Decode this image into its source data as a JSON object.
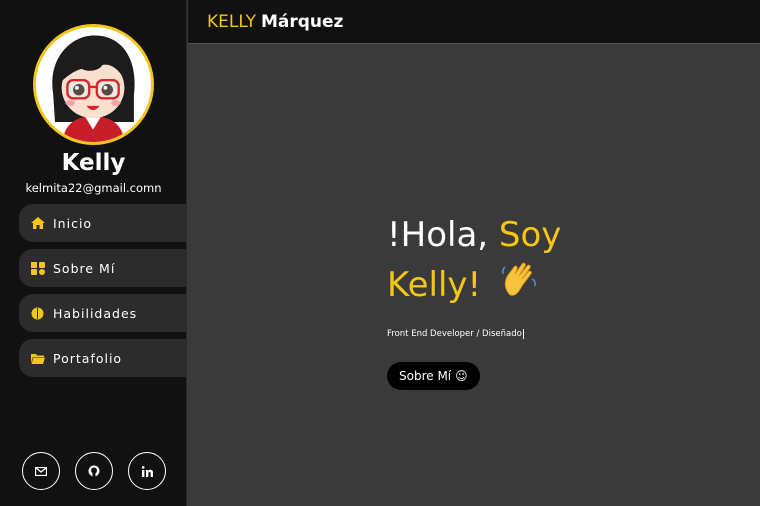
{
  "profile": {
    "name": "Kelly",
    "email": "kelmita22@gmail.comn"
  },
  "nav": [
    {
      "label": "Inicio",
      "icon": "home-icon"
    },
    {
      "label": "Sobre Mí",
      "icon": "puzzle-icon"
    },
    {
      "label": "Habilidades",
      "icon": "brain-icon"
    },
    {
      "label": "Portafolio",
      "icon": "folder-icon"
    }
  ],
  "header": {
    "brand_first": "KELLY",
    "brand_last": "Márquez"
  },
  "hero": {
    "greeting": "!Hola,",
    "soy": "Soy",
    "name": "Kelly!",
    "wave_emoji": "waving-hand-icon",
    "subtitle": "Front End Developer / Diseñado",
    "cta_label": "Sobre Mí",
    "cta_emoji": "☺"
  },
  "socials": [
    "mail-icon",
    "github-icon",
    "linkedin-icon"
  ],
  "colors": {
    "accent": "#f5c518",
    "sidebar_bg": "#111111",
    "main_bg": "#3a3a3a",
    "nav_item_bg": "#2c2c2c"
  }
}
